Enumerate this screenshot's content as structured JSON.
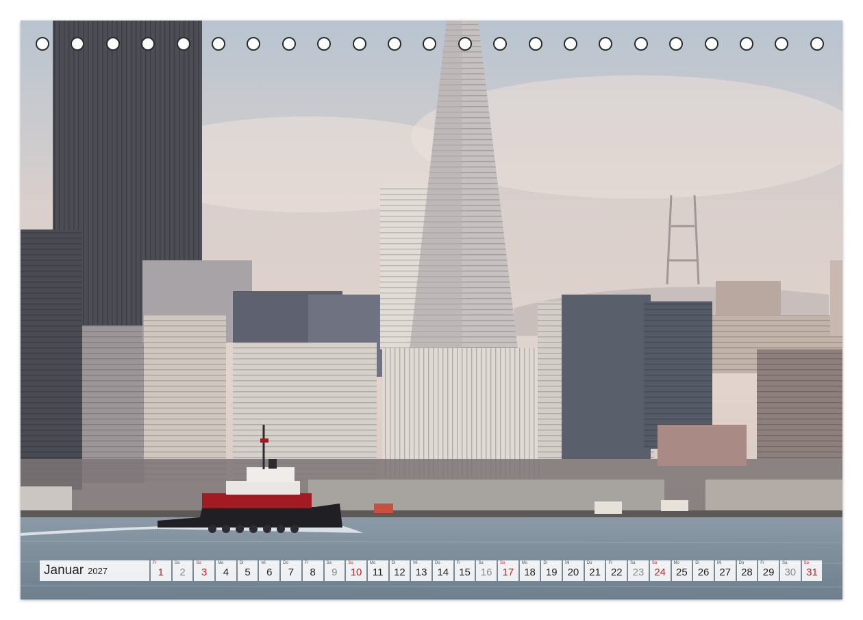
{
  "calendar": {
    "month": "Januar",
    "year": "2027",
    "days": [
      {
        "n": "1",
        "dow": "Fr",
        "kind": "holiday"
      },
      {
        "n": "2",
        "dow": "Sa",
        "kind": "weekend"
      },
      {
        "n": "3",
        "dow": "So",
        "kind": "sunday"
      },
      {
        "n": "4",
        "dow": "Mo",
        "kind": "weekday"
      },
      {
        "n": "5",
        "dow": "Di",
        "kind": "weekday"
      },
      {
        "n": "6",
        "dow": "Mi",
        "kind": "weekday"
      },
      {
        "n": "7",
        "dow": "Do",
        "kind": "weekday"
      },
      {
        "n": "8",
        "dow": "Fr",
        "kind": "weekday"
      },
      {
        "n": "9",
        "dow": "Sa",
        "kind": "weekend"
      },
      {
        "n": "10",
        "dow": "So",
        "kind": "sunday"
      },
      {
        "n": "11",
        "dow": "Mo",
        "kind": "weekday"
      },
      {
        "n": "12",
        "dow": "Di",
        "kind": "weekday"
      },
      {
        "n": "13",
        "dow": "Mi",
        "kind": "weekday"
      },
      {
        "n": "14",
        "dow": "Do",
        "kind": "weekday"
      },
      {
        "n": "15",
        "dow": "Fr",
        "kind": "weekday"
      },
      {
        "n": "16",
        "dow": "Sa",
        "kind": "weekend"
      },
      {
        "n": "17",
        "dow": "So",
        "kind": "sunday"
      },
      {
        "n": "18",
        "dow": "Mo",
        "kind": "weekday"
      },
      {
        "n": "19",
        "dow": "Di",
        "kind": "weekday"
      },
      {
        "n": "20",
        "dow": "Mi",
        "kind": "weekday"
      },
      {
        "n": "21",
        "dow": "Do",
        "kind": "weekday"
      },
      {
        "n": "22",
        "dow": "Fr",
        "kind": "weekday"
      },
      {
        "n": "23",
        "dow": "Sa",
        "kind": "weekend"
      },
      {
        "n": "24",
        "dow": "So",
        "kind": "sunday"
      },
      {
        "n": "25",
        "dow": "Mo",
        "kind": "weekday"
      },
      {
        "n": "26",
        "dow": "Di",
        "kind": "weekday"
      },
      {
        "n": "27",
        "dow": "Mi",
        "kind": "weekday"
      },
      {
        "n": "28",
        "dow": "Do",
        "kind": "weekday"
      },
      {
        "n": "29",
        "dow": "Fr",
        "kind": "weekday"
      },
      {
        "n": "30",
        "dow": "Sa",
        "kind": "weekend"
      },
      {
        "n": "31",
        "dow": "So",
        "kind": "sunday"
      }
    ]
  },
  "colors": {
    "holiday_red": "#c0202a",
    "tug_hull_red": "#a01c22"
  }
}
